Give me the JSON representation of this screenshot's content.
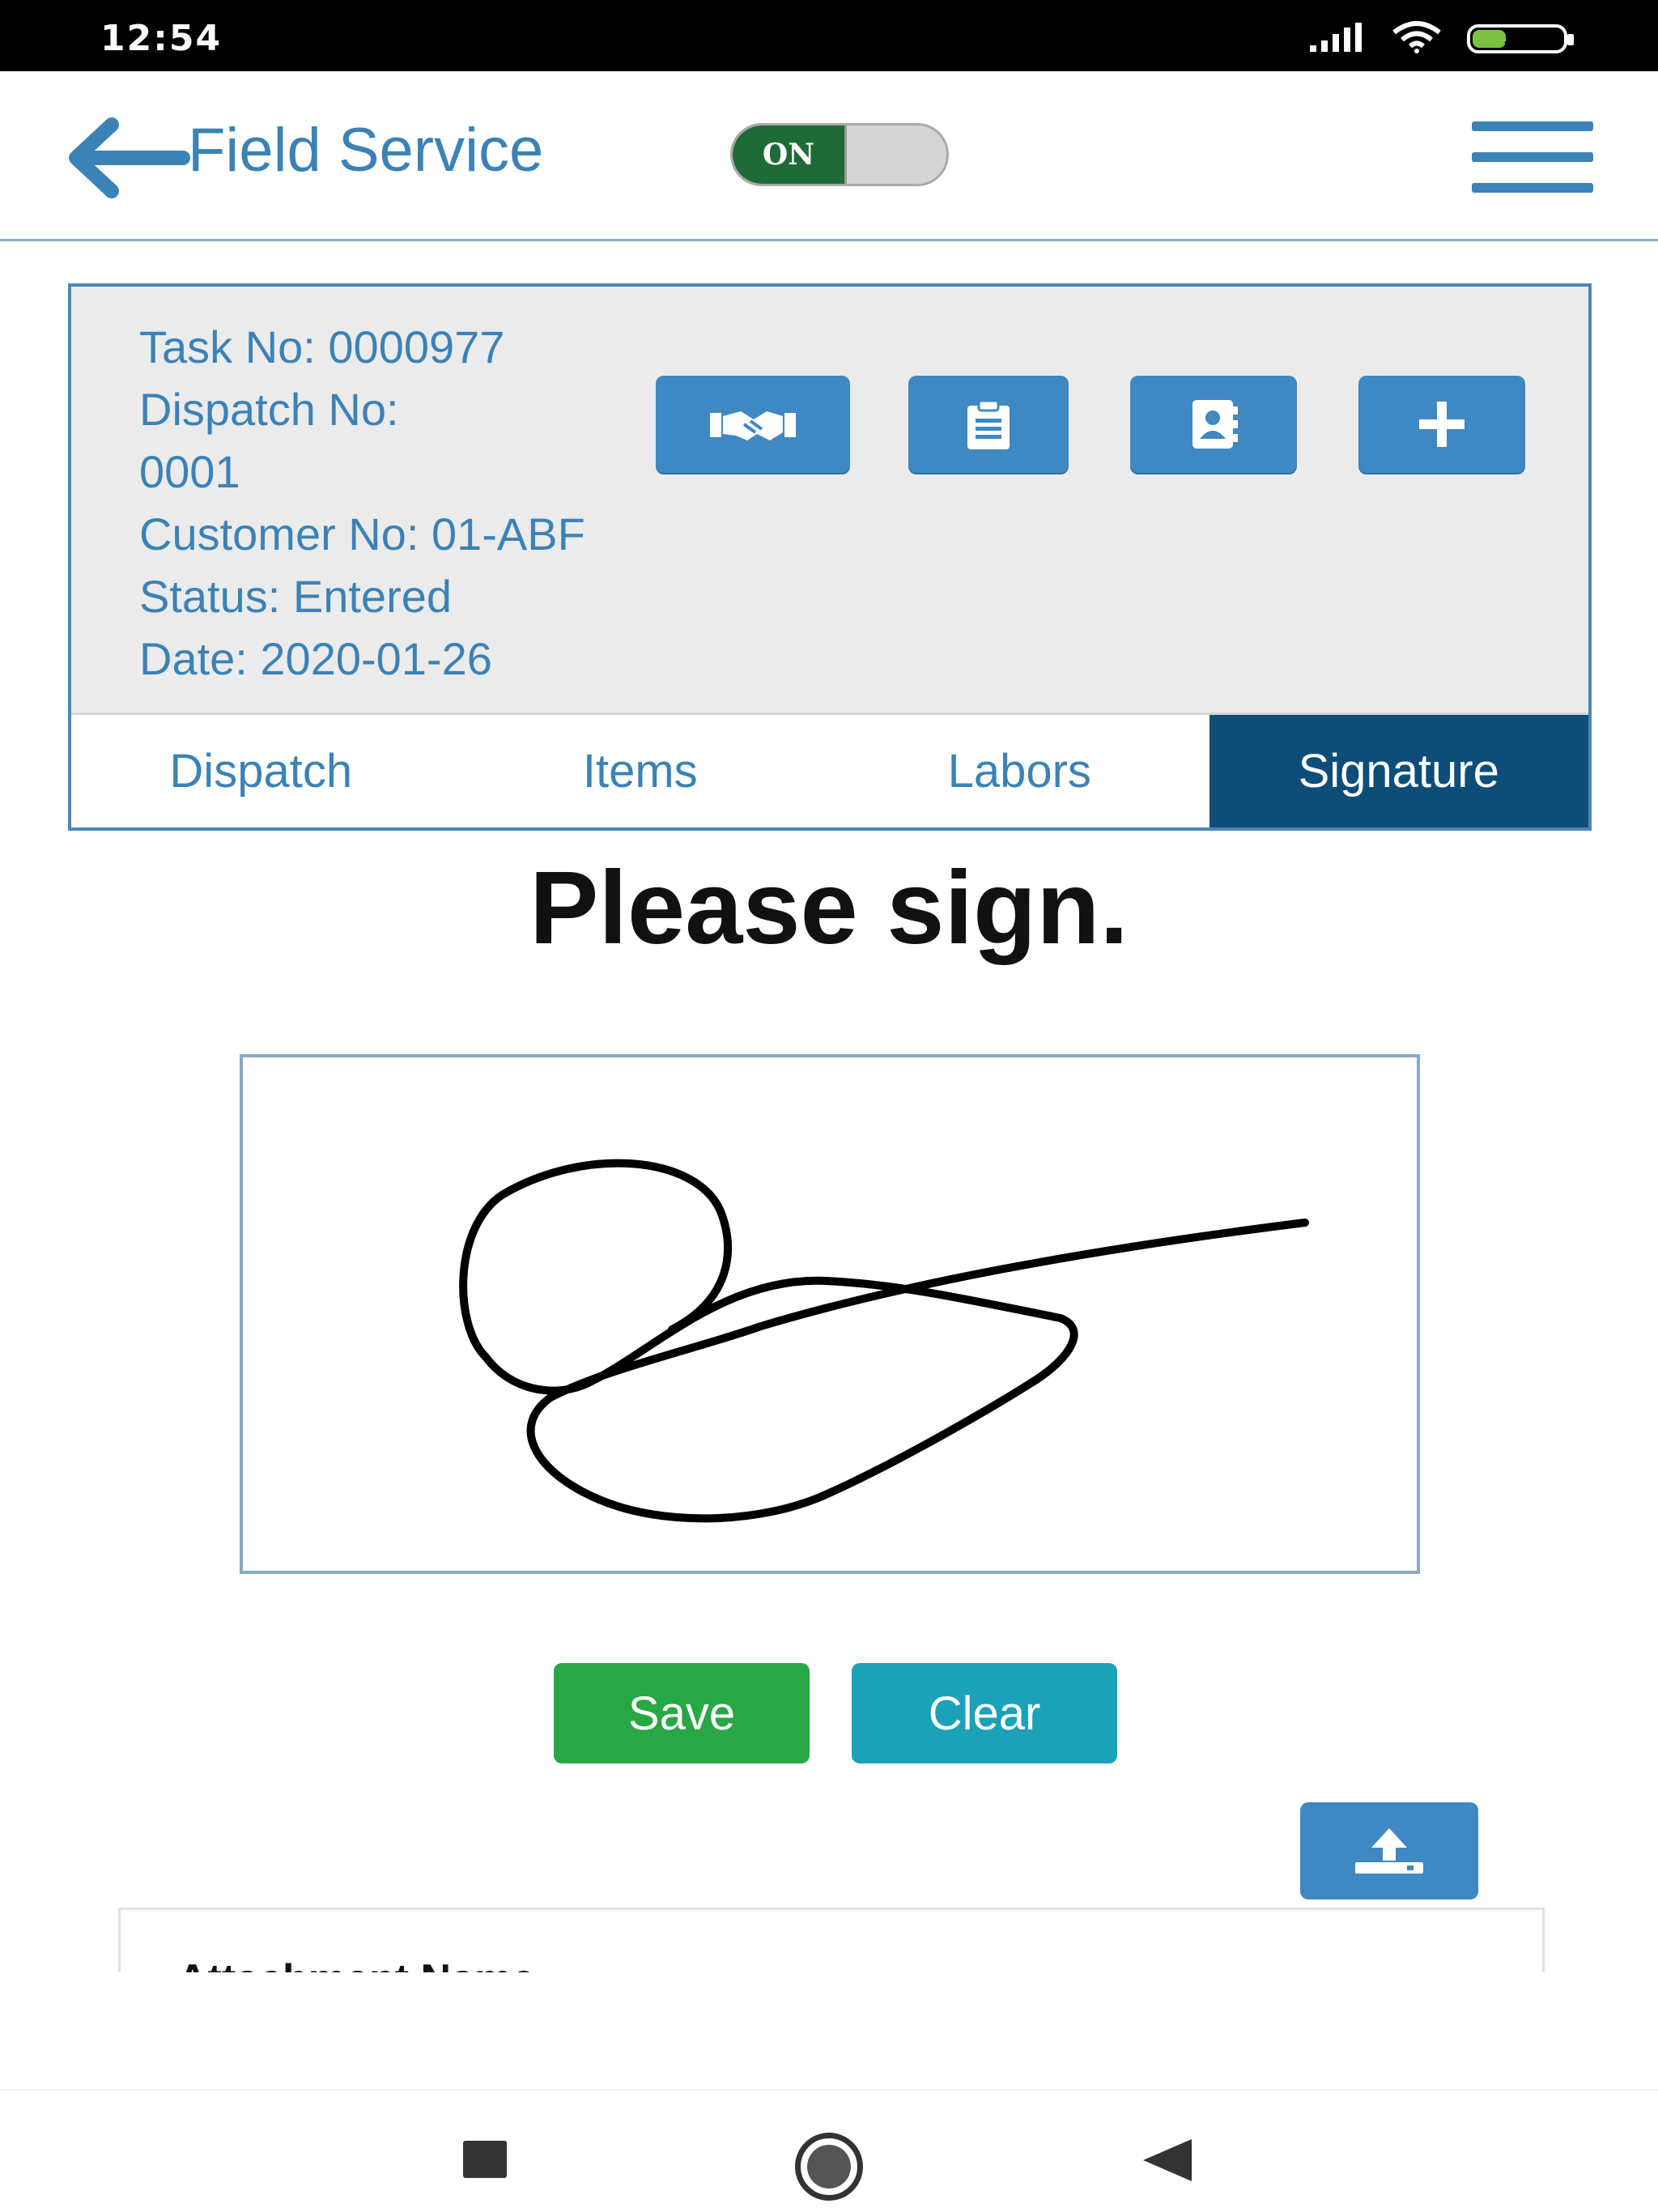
{
  "status_bar": {
    "time": "12:54",
    "battery": "37",
    "battery_level": 0.37
  },
  "header": {
    "title": "Field Service",
    "toggle_label": "ON",
    "toggle_on": true
  },
  "task": {
    "task_no": "Task No: 0000977",
    "dispatch_no_label": "Dispatch No:",
    "dispatch_no_value": "0001",
    "customer_no": "Customer No: 01-ABF",
    "status": "Status: Entered",
    "date": "Date: 2020-01-26"
  },
  "actions": [
    {
      "icon": "handshake-icon"
    },
    {
      "icon": "clipboard-icon"
    },
    {
      "icon": "contact-book-icon"
    },
    {
      "icon": "plus-icon"
    }
  ],
  "tabs": [
    {
      "label": "Dispatch",
      "active": false
    },
    {
      "label": "Items",
      "active": false
    },
    {
      "label": "Labors",
      "active": false
    },
    {
      "label": "Signature",
      "active": true
    }
  ],
  "signature": {
    "prompt": "Please sign.",
    "save_label": "Save",
    "clear_label": "Clear"
  },
  "attachments": {
    "header": "Attachment Name",
    "upload_icon": "upload-icon"
  },
  "colors": {
    "primary": "#3b82b6",
    "button_blue": "#3f88c2",
    "active_tab": "#0f4d79",
    "save_green": "#28a745",
    "clear_teal": "#1ba2b8",
    "toggle_green": "#1f6b37"
  }
}
